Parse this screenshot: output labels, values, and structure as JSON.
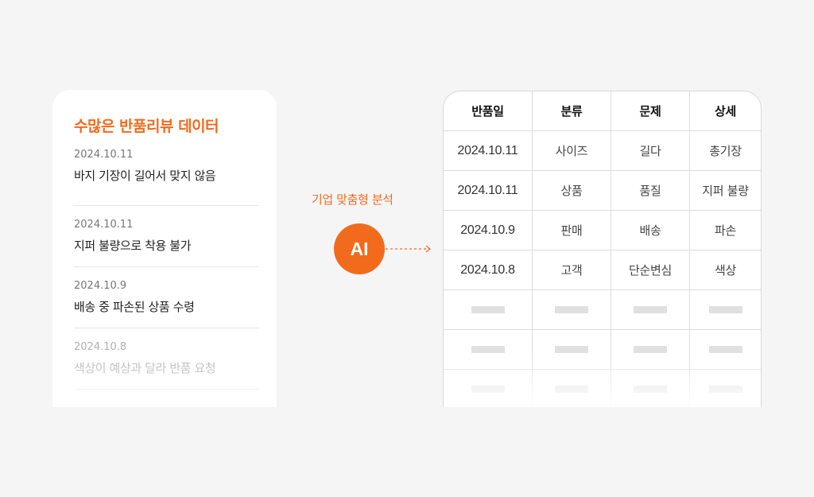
{
  "review_card": {
    "title": "수많은 반품리뷰 데이터",
    "reviews": [
      {
        "date": "2024.10.11",
        "text": "바지 기장이 길어서 맞지 않음"
      },
      {
        "date": "2024.10.11",
        "text": "지퍼 불량으로 착용 불가"
      },
      {
        "date": "2024.10.9",
        "text": "배송 중 파손된 상품 수령"
      },
      {
        "date": "2024.10.8",
        "text": "색상이 예상과 달라 반품 요청"
      }
    ]
  },
  "connector": {
    "label": "기업 맞춤형 분석",
    "badge": "AI"
  },
  "table": {
    "headers": [
      "반품일",
      "분류",
      "문제",
      "상세"
    ],
    "rows": [
      [
        "2024.10.11",
        "사이즈",
        "길다",
        "총기장"
      ],
      [
        "2024.10.11",
        "상품",
        "품질",
        "지퍼 불량"
      ],
      [
        "2024.10.9",
        "판매",
        "배송",
        "파손"
      ],
      [
        "2024.10.8",
        "고객",
        "단순변심",
        "색상"
      ]
    ],
    "placeholder_rows": 3
  },
  "colors": {
    "accent": "#f26b1d",
    "background": "#f5f5f5"
  }
}
